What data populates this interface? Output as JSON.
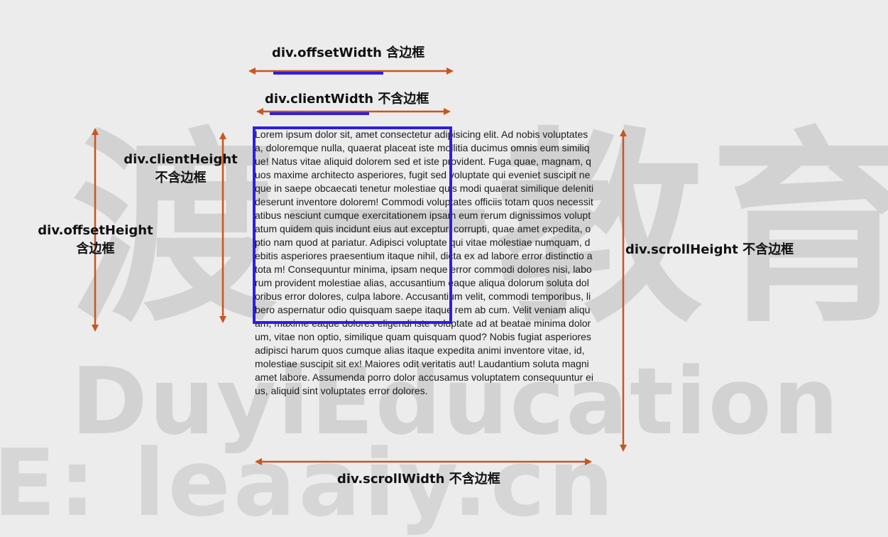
{
  "watermark": {
    "chinese": "渡一教育",
    "english": "DuyiEducation",
    "url": "E: leaaiy.cn"
  },
  "labels": {
    "offset_width": "div.offsetWidth 含边框",
    "client_width": "div.clientWidth 不含边框",
    "client_height_1": "div.clientHeight",
    "client_height_2": "不含边框",
    "offset_height_1": "div.offsetHeight",
    "offset_height_2": "含边框",
    "scroll_height": "div.scrollHeight 不含边框",
    "scroll_width": "div.scrollWidth 不含边框"
  },
  "content_text": "Lorem ipsum dolor sit, amet consectetur adipisicing elit. Ad nobis voluptates a, doloremque nulla, quaerat placeat iste mollitia ducimus omnis eum similique! Natus vitae aliquid dolorem sed et iste provident. Fuga quae, magnam, quos maxime architecto asperiores, fugit sed voluptate qui eveniet suscipit neque in saepe obcaecati tenetur molestiae quis modi quaerat similique deleniti deserunt inventore dolorem! Commodi voluptates officiis totam quos necessitatibus nesciunt cumque exercitationem ipsam eum rerum dignissimos voluptatum quidem quis incidunt eius aut excepturi corrupti, quae amet expedita, optio nam quod at pariatur. Adipisci voluptate qui vitae molestiae numquam, debitis asperiores praesentium itaque nihil, dicta ex ad labore error distinctio a tota m! Consequuntur minima, ipsam neque error commodi dolores nisi, laborum provident molestiae alias, accusantium eaque aliqua dolorum soluta doloribus error dolores, culpa labore. Accusantium velit, commodi temporibus, libero aspernatur odio quisquam saepe itaque rem ab cum. Velit veniam aliquam, maxime eaque dolores eligendi iste voluptate ad at beatae minima dolorum, vitae non optio, similique quam quisquam quod? Nobis fugiat asperiores adipisci harum quos cumque alias itaque expedita animi inventore vitae, id, molestiae suscipit sit ex! Maiores odit veritatis aut! Laudantium soluta magni amet labore. Assumenda porro dolor accusamus voluptatem consequuntur eius, aliquid sint voluptates error dolores.",
  "colors": {
    "arrow": "#c8561f",
    "box_border": "#2d1ee0",
    "underline": "#2d1ee0"
  }
}
